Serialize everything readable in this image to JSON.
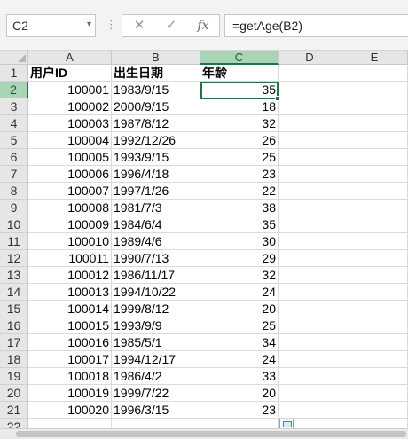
{
  "formula_bar": {
    "name_box": "C2",
    "name_caret": "▾",
    "separator": "⋮",
    "cancel_glyph": "✕",
    "enter_glyph": "✓",
    "fx_label": "fx",
    "formula": "=getAge(B2)"
  },
  "grid": {
    "columns": [
      "A",
      "B",
      "C",
      "D",
      "E"
    ],
    "header_row": {
      "row": "1",
      "a": "用户ID",
      "b": "出生日期",
      "c": "年龄"
    },
    "rows": [
      {
        "row": "2",
        "id": "100001",
        "birth": "1983/9/15",
        "age": "35"
      },
      {
        "row": "3",
        "id": "100002",
        "birth": "2000/9/15",
        "age": "18"
      },
      {
        "row": "4",
        "id": "100003",
        "birth": "1987/8/12",
        "age": "32"
      },
      {
        "row": "5",
        "id": "100004",
        "birth": "1992/12/26",
        "age": "26"
      },
      {
        "row": "6",
        "id": "100005",
        "birth": "1993/9/15",
        "age": "25"
      },
      {
        "row": "7",
        "id": "100006",
        "birth": "1996/4/18",
        "age": "23"
      },
      {
        "row": "8",
        "id": "100007",
        "birth": "1997/1/26",
        "age": "22"
      },
      {
        "row": "9",
        "id": "100008",
        "birth": "1981/7/3",
        "age": "38"
      },
      {
        "row": "10",
        "id": "100009",
        "birth": "1984/6/4",
        "age": "35"
      },
      {
        "row": "11",
        "id": "100010",
        "birth": "1989/4/6",
        "age": "30"
      },
      {
        "row": "12",
        "id": "100011",
        "birth": "1990/7/13",
        "age": "29"
      },
      {
        "row": "13",
        "id": "100012",
        "birth": "1986/11/17",
        "age": "32"
      },
      {
        "row": "14",
        "id": "100013",
        "birth": "1994/10/22",
        "age": "24"
      },
      {
        "row": "15",
        "id": "100014",
        "birth": "1999/8/12",
        "age": "20"
      },
      {
        "row": "16",
        "id": "100015",
        "birth": "1993/9/9",
        "age": "25"
      },
      {
        "row": "17",
        "id": "100016",
        "birth": "1985/5/1",
        "age": "34"
      },
      {
        "row": "18",
        "id": "100017",
        "birth": "1994/12/17",
        "age": "24"
      },
      {
        "row": "19",
        "id": "100018",
        "birth": "1986/4/2",
        "age": "33"
      },
      {
        "row": "20",
        "id": "100019",
        "birth": "1999/7/22",
        "age": "20"
      },
      {
        "row": "21",
        "id": "100020",
        "birth": "1996/3/15",
        "age": "23"
      },
      {
        "row": "22",
        "id": "",
        "birth": "",
        "age": ""
      }
    ],
    "active_cell": "C2",
    "selection_color": "#217346"
  }
}
